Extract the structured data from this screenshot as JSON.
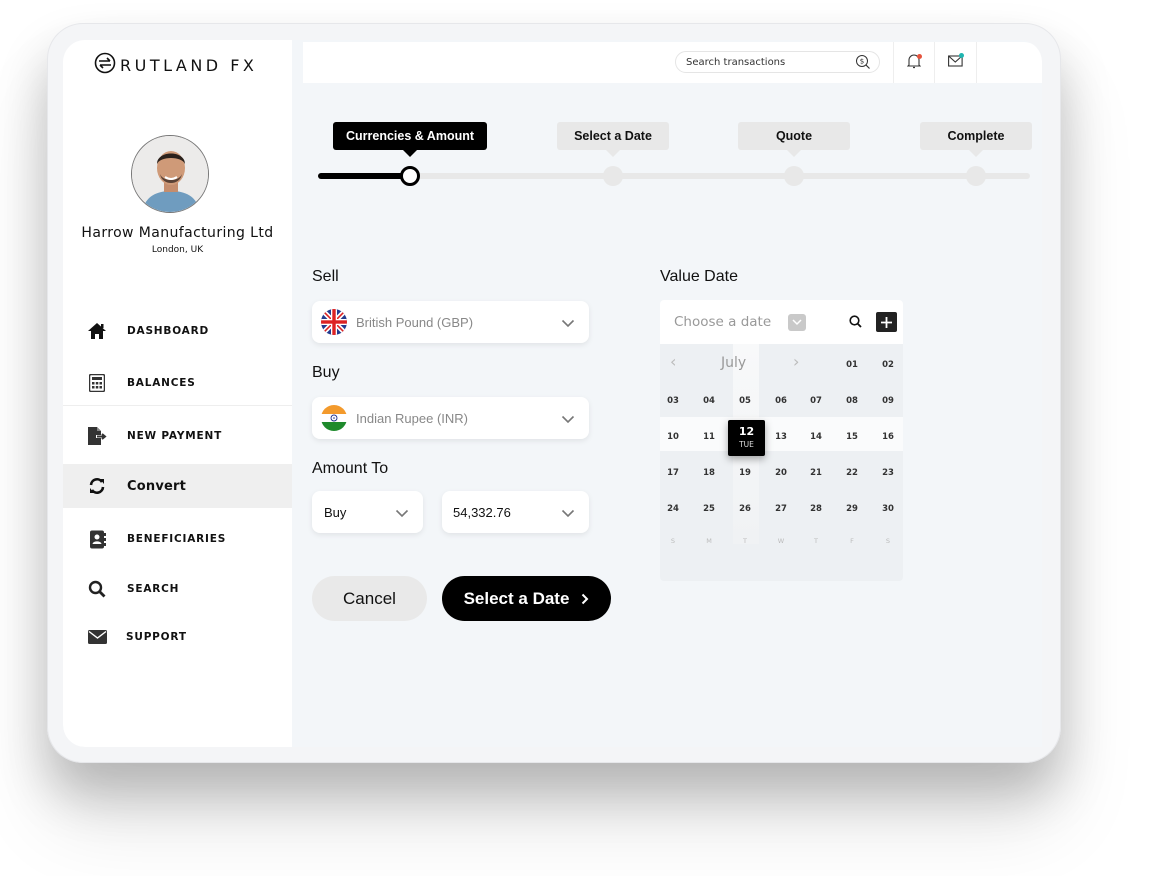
{
  "brand": {
    "name": "RUTLAND FX",
    "logo_icon": "exchange-arrows-circle-icon"
  },
  "profile": {
    "company": "Harrow Manufacturing Ltd",
    "location": "London, UK"
  },
  "sidebar": {
    "items": [
      {
        "label": "DASHBOARD",
        "icon": "home-icon",
        "active": false
      },
      {
        "label": "BALANCES",
        "icon": "calculator-icon",
        "active": false
      },
      {
        "label": "NEW PAYMENT",
        "icon": "file-export-icon",
        "active": false
      },
      {
        "label": "Convert",
        "icon": "refresh-icon",
        "active": true
      },
      {
        "label": "BENEFICIARIES",
        "icon": "contact-book-icon",
        "active": false
      },
      {
        "label": "SEARCH",
        "icon": "search-icon",
        "active": false
      },
      {
        "label": "SUPPORT",
        "icon": "envelope-icon",
        "active": false
      }
    ]
  },
  "topbar": {
    "search_placeholder": "Search transactions",
    "search_icon": "dollar-search-icon",
    "notifications": {
      "icon": "bell-icon",
      "badge_color": "#e5533d"
    },
    "messages": {
      "icon": "mail-icon",
      "badge_color": "#1fb5b0"
    }
  },
  "stepper": {
    "current_step": 1,
    "steps": [
      {
        "label": "Currencies & Amount"
      },
      {
        "label": "Select a Date"
      },
      {
        "label": "Quote"
      },
      {
        "label": "Complete"
      }
    ]
  },
  "form": {
    "sell": {
      "label": "Sell",
      "value": "British Pound (GBP)",
      "flag": "uk-flag-icon"
    },
    "buy": {
      "label": "Buy",
      "value": "Indian Rupee (INR)",
      "flag": "india-flag-icon"
    },
    "amount": {
      "label": "Amount To",
      "direction": "Buy",
      "value": "54,332.76"
    },
    "cancel_label": "Cancel",
    "next_label": "Select a Date"
  },
  "value_date": {
    "label": "Value Date",
    "placeholder": "Choose a date",
    "month": "July",
    "first_row": [
      "01",
      "02"
    ],
    "weeks": [
      [
        "03",
        "04",
        "05",
        "06",
        "07",
        "08",
        "09"
      ],
      [
        "10",
        "11",
        "12",
        "13",
        "14",
        "15",
        "16"
      ],
      [
        "17",
        "18",
        "19",
        "20",
        "21",
        "22",
        "23"
      ],
      [
        "24",
        "25",
        "26",
        "27",
        "28",
        "29",
        "30"
      ]
    ],
    "weekdays": [
      "S",
      "M",
      "T",
      "W",
      "T",
      "F",
      "S"
    ],
    "selected": {
      "day": "12",
      "weekday": "TUE"
    }
  }
}
